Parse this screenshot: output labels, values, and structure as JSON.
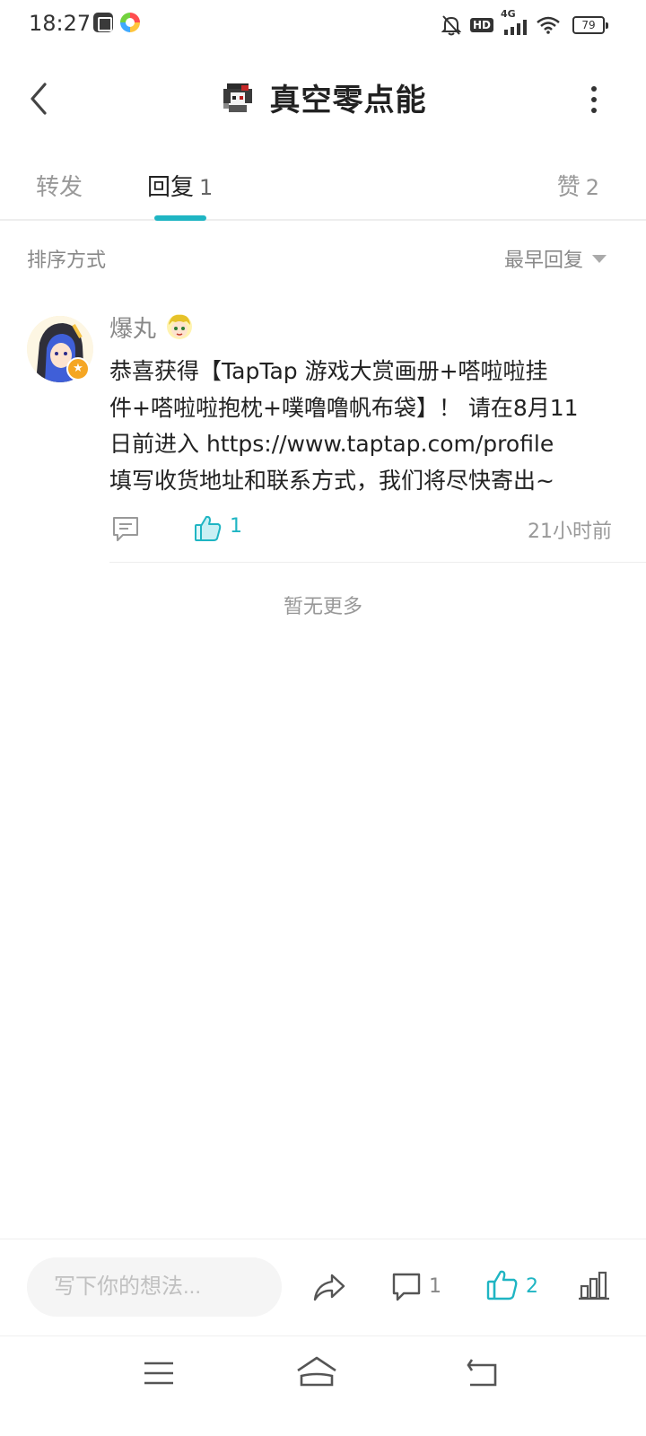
{
  "status_bar": {
    "time": "18:27",
    "hd_label": "HD",
    "network_label": "4G",
    "battery": "79",
    "icons": [
      "gallery-app-icon",
      "browser-app-icon",
      "mute-icon",
      "signal-icon",
      "wifi-icon",
      "battery-icon"
    ]
  },
  "header": {
    "title": "真空零点能",
    "icons": [
      "back-chevron-icon",
      "pixel-avatar-icon",
      "more-vertical-icon"
    ]
  },
  "tabs": [
    {
      "label": "转发",
      "count": ""
    },
    {
      "label": "回复",
      "count": "1"
    },
    {
      "label": "赞",
      "count": "2"
    }
  ],
  "sort": {
    "label": "排序方式",
    "selected": "最早回复"
  },
  "comment": {
    "username": "爆丸",
    "body_lines": [
      "恭喜获得【TapTap 游戏大赏画册+嗒啦啦挂",
      "件+嗒啦啦抱枕+噗噜噜帆布袋】！ 请在8月11",
      "日前进入 https://www.taptap.com/profile",
      "填写收货地址和联系方式，我们将尽快寄出~"
    ],
    "like_count": "1",
    "time": "21小时前"
  },
  "no_more": "暂无更多",
  "bottom_bar": {
    "placeholder": "写下你的想法...",
    "comment_count": "1",
    "like_count": "2"
  },
  "colors": {
    "accent": "#1fb5c3",
    "muted_text": "#999999",
    "body_text": "#222222"
  }
}
